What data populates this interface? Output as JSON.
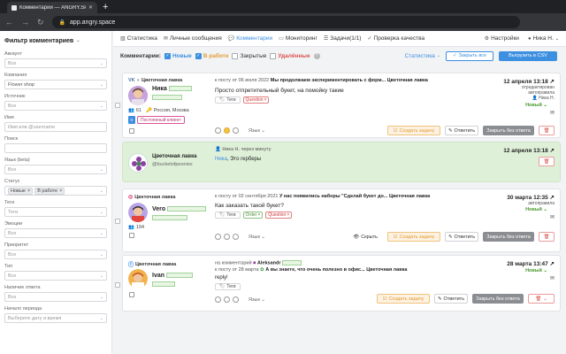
{
  "browser": {
    "tab_title": "Комментарии — ANGRY.SPACE",
    "url": "app.angry.space"
  },
  "sidebar": {
    "title": "Фильтр комментариев",
    "fields": [
      {
        "label": "Аккаунт",
        "value": "Все"
      },
      {
        "label": "Компания",
        "value": "Flower shop"
      },
      {
        "label": "Источник",
        "value": "Все"
      },
      {
        "label": "Имя",
        "value": "Имя или @username"
      },
      {
        "label": "Поиск",
        "value": ""
      },
      {
        "label": "Язык (beta)",
        "value": "Все"
      },
      {
        "label": "Статус",
        "chips": [
          "Новые",
          "В работе"
        ]
      },
      {
        "label": "Теги",
        "value": "Теги"
      },
      {
        "label": "Эмоции",
        "value": "Все"
      },
      {
        "label": "Приоритет",
        "value": "Все"
      },
      {
        "label": "Тип",
        "value": "Все"
      },
      {
        "label": "Наличие ответа",
        "value": "Все"
      },
      {
        "label": "Начало периода",
        "value": "Выберите дату и время"
      }
    ]
  },
  "nav": {
    "items": [
      {
        "label": "Статистика",
        "icon": "bar-chart-icon"
      },
      {
        "label": "Личные сообщения",
        "icon": "envelope-icon"
      },
      {
        "label": "Комментарии",
        "icon": "comment-icon"
      },
      {
        "label": "Мониторинг",
        "icon": "monitor-icon"
      },
      {
        "label": "Задачи(1/1)",
        "icon": "tasks-icon"
      },
      {
        "label": "Проверка качества",
        "icon": "check-icon"
      }
    ],
    "settings": "Настройки",
    "user": "Ника Н."
  },
  "filterbar": {
    "title": "Комментарии:",
    "options": [
      {
        "label": "Новые",
        "checked": true,
        "color": "#3d8fe0"
      },
      {
        "label": "В работе",
        "checked": true,
        "color": "#e39b35"
      },
      {
        "label": "Закрытые",
        "checked": false,
        "color": "#333333"
      },
      {
        "label": "Удалённые",
        "checked": false,
        "color": "#d9534f"
      }
    ],
    "help": "?",
    "stats": "Статистика",
    "close_all": "Закрыть все",
    "export": "Выгрузить в CSV"
  },
  "cards": [
    {
      "source": "Цветочная лавка",
      "user": "Ника",
      "meta_count": "61",
      "meta_location": "Россия, Москва",
      "client_tag": "Постоянный клиент",
      "post": "к посту от 06 июля 2022",
      "post_title": "Мы продолжаем экспериментировать с форм...",
      "post_account": "Цветочная лавка",
      "text": "Просто отпретительный букет, на помойку такие",
      "tags_label": "Теги",
      "tags": [
        {
          "text": "Question",
          "kind": "red"
        }
      ],
      "date": "12 апреля 13:18",
      "info1": "отредактирован",
      "info2": "автоправила",
      "info3": "Ника Н.",
      "status": "Новый",
      "lang": "Язык"
    },
    {
      "source_name": "Цветочная лавка",
      "handle": "@bucketofpeonies",
      "info": "Ника Н. через минуту",
      "reply_name": "Ника",
      "reply_text": ", Это герберы",
      "date": "12 апреля 13:18"
    },
    {
      "source": "Цветочная лавка",
      "user": "Vero",
      "meta_count": "194",
      "post": "к посту от 02 сентября 2021",
      "post_title": "У нас появились наборы \"Сделай букет до...",
      "post_account": "Цветочная лавка",
      "text": "Как заказать такой букет?",
      "tags_label": "Теги",
      "tags": [
        {
          "text": "Order",
          "kind": "green"
        },
        {
          "text": "Question",
          "kind": "red"
        }
      ],
      "date": "30 марта 12:35",
      "info1": "автоправила",
      "status": "Новый",
      "lang": "Язык",
      "hide": "Скрыть"
    },
    {
      "source": "Цветочная лавка",
      "user": "Ivan",
      "post_prefix": "на комментарий",
      "post_user": "Aleksandr",
      "post": "к посту от 28 марта",
      "post_title": "А вы знаете, что очень полезно в офис...",
      "post_account": "Цветочная лавка",
      "text": "reply!",
      "tags_label": "Теги",
      "date": "28 марта 13:47",
      "status": "Новый",
      "lang": "Язык"
    }
  ],
  "actions": {
    "task": "Создать задачу",
    "reply": "Ответить",
    "close": "Закрыть без ответа"
  },
  "colors": {
    "accent": "#3d8fe0",
    "orange": "#e39b35",
    "red": "#d9534f",
    "status_green": "#4a9a2e",
    "reply_bg": "#dff0d8"
  }
}
